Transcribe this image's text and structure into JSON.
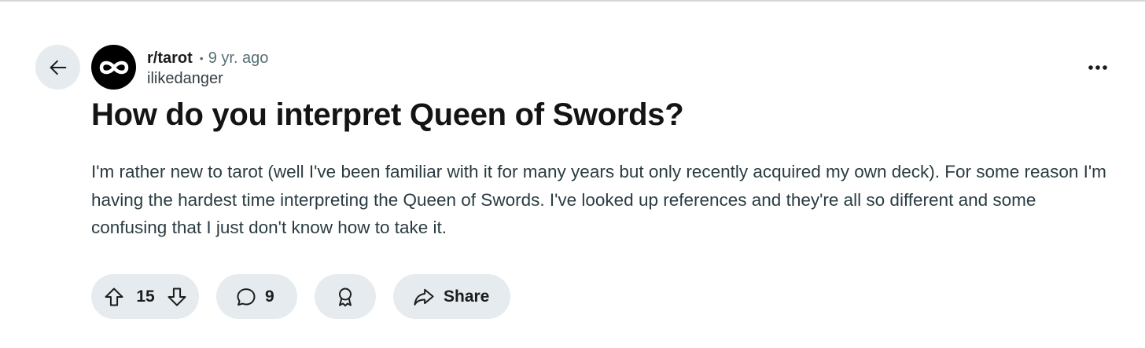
{
  "post": {
    "subreddit": "r/tarot",
    "separator": "•",
    "time_ago": "9 yr. ago",
    "author": "ilikedanger",
    "title": "How do you interpret Queen of Swords?",
    "body": "I'm rather new to tarot (well I've been familiar with it for many years but only recently acquired my own deck). For some reason I'm having the hardest time interpreting the Queen of Swords. I've looked up references and they're all so different and some confusing that I just don't know how to take it."
  },
  "actions": {
    "vote_count": "15",
    "comment_count": "9",
    "share_label": "Share"
  },
  "icons": {
    "back": "arrow-left-icon",
    "avatar": "infinity-icon",
    "more": "more-horizontal-icon",
    "upvote": "arrow-up-outline-icon",
    "downvote": "arrow-down-outline-icon",
    "comment": "speech-bubble-icon",
    "award": "award-ribbon-icon",
    "share": "share-arrow-icon"
  },
  "colors": {
    "pill_background": "#e5ebee",
    "text_primary": "#1c1c1c",
    "text_secondary": "#576f76",
    "body_text": "#2a3c42"
  }
}
